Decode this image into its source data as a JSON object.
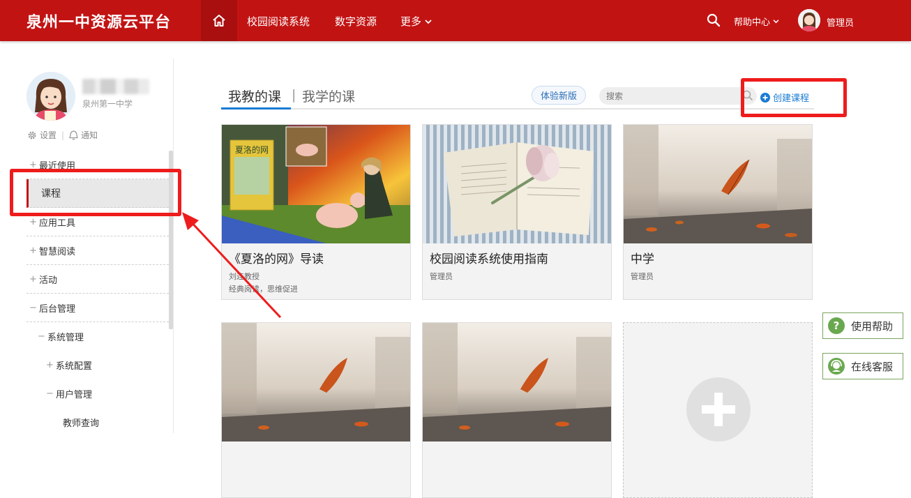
{
  "header": {
    "brand": "泉州一中资源云平台",
    "nav": [
      "校园阅读系统",
      "数字资源"
    ],
    "more": "更多",
    "help": "帮助中心",
    "admin": "管理员"
  },
  "profile": {
    "school": "泉州第一中学",
    "settings": "设置",
    "notify": "通知"
  },
  "sidebar": {
    "items": [
      {
        "label": "最近使用",
        "sign": "+"
      },
      {
        "label": "课程",
        "sign": ""
      },
      {
        "label": "应用工具",
        "sign": "+"
      },
      {
        "label": "智慧阅读",
        "sign": "+"
      },
      {
        "label": "活动",
        "sign": "+"
      },
      {
        "label": "后台管理",
        "sign": "−"
      },
      {
        "label": "系统管理",
        "sign": "−"
      },
      {
        "label": "系统配置",
        "sign": "+"
      },
      {
        "label": "用户管理",
        "sign": "−"
      },
      {
        "label": "教师查询",
        "sign": ""
      }
    ]
  },
  "content": {
    "tab_mine": "我教的课",
    "tab_sep": "|",
    "tab_learn": "我学的课",
    "new_version": "体验新版",
    "search_placeholder": "搜索",
    "create": "创建课程"
  },
  "cards": [
    {
      "title": "《夏洛的网》导读",
      "author": "刘连教授",
      "desc": "经典阅读，思维促进",
      "book_title": "夏洛的网"
    },
    {
      "title": "校园阅读系统使用指南",
      "author": "管理员",
      "desc": ""
    },
    {
      "title": "中学",
      "author": "管理员",
      "desc": ""
    }
  ],
  "floats": {
    "help": "使用帮助",
    "service": "在线客服"
  },
  "colors": {
    "brand_red": "#c21313",
    "accent_blue": "#1a7bd4",
    "highlight_red": "#ee1c1c"
  }
}
